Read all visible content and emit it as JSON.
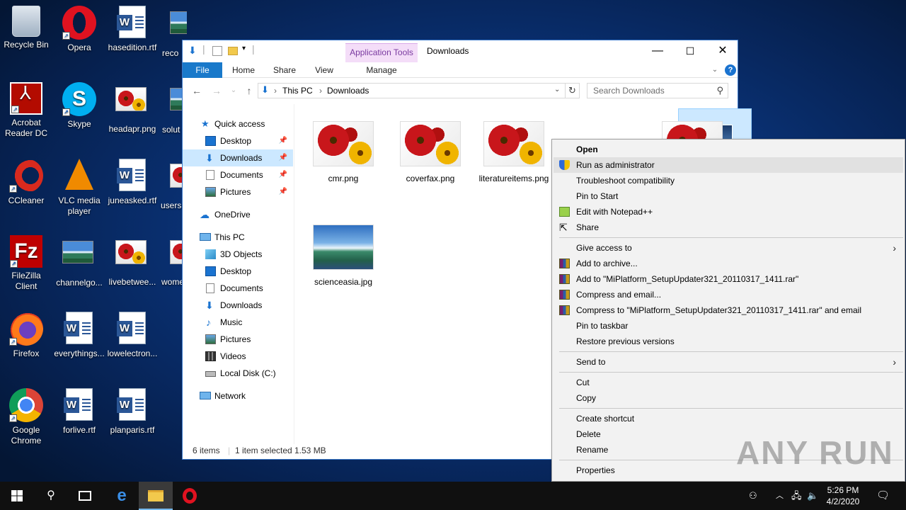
{
  "desktop": {
    "icons": [
      {
        "label": "Recycle Bin"
      },
      {
        "label": "Opera"
      },
      {
        "label": "hasedition.rtf"
      },
      {
        "label": "reco"
      },
      {
        "label": "Acrobat Reader DC"
      },
      {
        "label": "Skype"
      },
      {
        "label": "headapr.png"
      },
      {
        "label": "solut"
      },
      {
        "label": "CCleaner"
      },
      {
        "label": "VLC media player"
      },
      {
        "label": "juneasked.rtf"
      },
      {
        "label": "usersr"
      },
      {
        "label": "FileZilla Client"
      },
      {
        "label": "channelgo..."
      },
      {
        "label": "livebetwee..."
      },
      {
        "label": "wome"
      },
      {
        "label": "Firefox"
      },
      {
        "label": "everythings..."
      },
      {
        "label": "lowelectron..."
      },
      {
        "label": "Google Chrome"
      },
      {
        "label": "forlive.rtf"
      },
      {
        "label": "planparis.rtf"
      }
    ]
  },
  "explorer": {
    "title": "Downloads",
    "app_tools": "Application Tools",
    "controls": {
      "minimize": "—",
      "maximize": "☐",
      "close": "✕"
    },
    "tabs": {
      "file": "File",
      "home": "Home",
      "share": "Share",
      "view": "View",
      "manage": "Manage"
    },
    "address": {
      "crumb1": "This PC",
      "sep": "›",
      "crumb2": "Downloads"
    },
    "search_placeholder": "Search Downloads",
    "nav": {
      "quick_access": "Quick access",
      "qa_desktop": "Desktop",
      "qa_downloads": "Downloads",
      "qa_documents": "Documents",
      "qa_pictures": "Pictures",
      "onedrive": "OneDrive",
      "this_pc": "This PC",
      "objects3d": "3D Objects",
      "pc_desktop": "Desktop",
      "pc_documents": "Documents",
      "pc_downloads": "Downloads",
      "music": "Music",
      "pc_pictures": "Pictures",
      "videos": "Videos",
      "local_disk": "Local Disk (C:)",
      "network": "Network"
    },
    "files": [
      {
        "name": "cmr.png"
      },
      {
        "name": "coverfax.png"
      },
      {
        "name": "literatureitems.png"
      },
      {
        "name": "scienceasia.jpg"
      }
    ],
    "status": {
      "count": "6 items",
      "selection": "1 item selected",
      "size": "1.53 MB"
    }
  },
  "context_menu": {
    "open": "Open",
    "run_admin": "Run as administrator",
    "troubleshoot": "Troubleshoot compatibility",
    "pin_start": "Pin to Start",
    "edit_npp": "Edit with Notepad++",
    "share": "Share",
    "give_access": "Give access to",
    "add_archive": "Add to archive...",
    "add_rar": "Add to \"MiPlatform_SetupUpdater321_20110317_1411.rar\"",
    "compress_email": "Compress and email...",
    "compress_rar_email": "Compress to \"MiPlatform_SetupUpdater321_20110317_1411.rar\" and email",
    "pin_taskbar": "Pin to taskbar",
    "restore": "Restore previous versions",
    "send_to": "Send to",
    "cut": "Cut",
    "copy": "Copy",
    "create_shortcut": "Create shortcut",
    "delete": "Delete",
    "rename": "Rename",
    "properties": "Properties"
  },
  "taskbar": {
    "time": "5:26 PM",
    "date": "4/2/2020"
  },
  "watermark": "ANY RUN"
}
